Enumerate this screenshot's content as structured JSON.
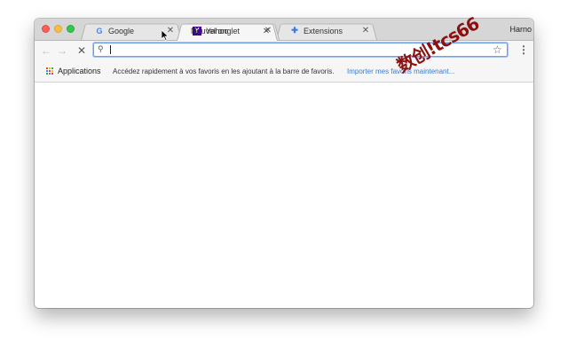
{
  "tabs": [
    {
      "title": "Google",
      "favicon": "google-icon",
      "favicon_color": "#4285f4",
      "active": false
    },
    {
      "title": "Nouvel onglet",
      "favicon": "",
      "active": true
    },
    {
      "title": "Yahoo",
      "favicon": "yahoo-icon",
      "favicon_color": "#400090",
      "active": false
    },
    {
      "title": "Extensions",
      "favicon": "puzzle-icon",
      "favicon_color": "#3b78e7",
      "active": false
    }
  ],
  "profile_name": "Harno",
  "omnibox": {
    "value": "",
    "placeholder": ""
  },
  "bookmarks": {
    "apps_label": "Applications",
    "hint": "Accédez rapidement à vos favoris en les ajoutant à la barre de favoris.",
    "import_link": "Importer mes favoris maintenant..."
  },
  "watermark": "数创!tcs66",
  "colors": {
    "traffic_close": "#fc605b",
    "traffic_min": "#fdbc40",
    "traffic_max": "#34c84a",
    "link": "#3b7bc8",
    "watermark": "#8c1010"
  }
}
